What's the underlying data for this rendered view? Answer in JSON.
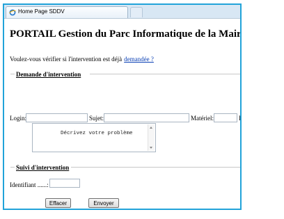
{
  "browser": {
    "tab_title": "Home Page SDDV"
  },
  "page": {
    "title": "PORTAIL Gestion du Parc Informatique de la Mairie",
    "question_text": "Voulez-vous vérifier si l'intervention est déjà",
    "question_link": "demandée ?"
  },
  "demande": {
    "legend": "Demande d'intervention",
    "login_label": "Login:",
    "login_value": "",
    "sujet_label": "Sujet:",
    "sujet_value": "",
    "materiel_label": "Matériel:",
    "materiel_value": "",
    "extra_label": "I",
    "textarea_text": "    Décrivez votre problème"
  },
  "suivi": {
    "legend": "Suivi d'intervention",
    "identifiant_label": "Identifiant ......:",
    "identifiant_value": ""
  },
  "buttons": {
    "clear": "Effacer",
    "submit": "Envoyer"
  },
  "colors": {
    "frame_border": "#21a3d9",
    "link": "#0b40b5"
  }
}
